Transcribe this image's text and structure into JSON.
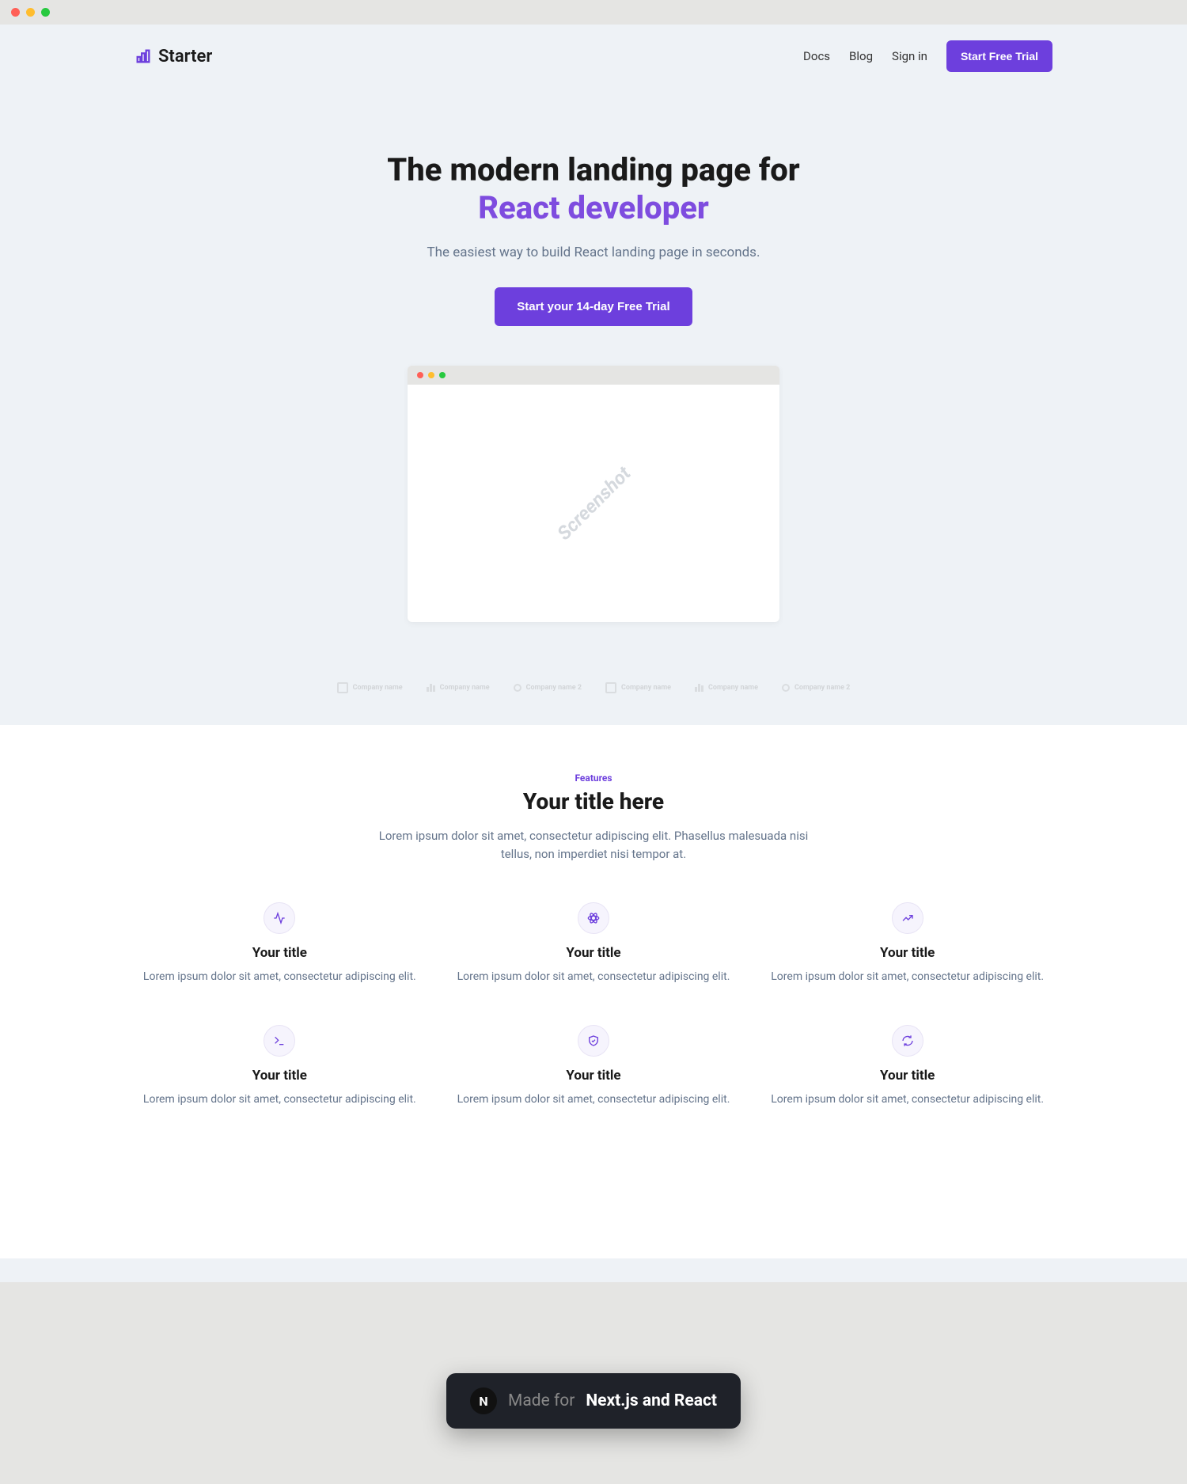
{
  "header": {
    "logo_text": "Starter",
    "nav": [
      "Docs",
      "Blog",
      "Sign in"
    ],
    "cta": "Start Free Trial"
  },
  "hero": {
    "title_line1": "The modern landing page for",
    "title_accent": "React developer",
    "subtitle": "The easiest way to build React landing page in seconds.",
    "cta": "Start your 14-day Free Trial",
    "screenshot_watermark": "Screenshot"
  },
  "logos": [
    "Company name",
    "Company name",
    "Company name 2",
    "Company name",
    "Company name",
    "Company name 2"
  ],
  "features": {
    "eyebrow": "Features",
    "title": "Your title here",
    "subtitle": "Lorem ipsum dolor sit amet, consectetur adipiscing elit. Phasellus malesuada nisi tellus, non imperdiet nisi tempor at.",
    "items": [
      {
        "title": "Your title",
        "desc": "Lorem ipsum dolor sit amet, consectetur adipiscing elit."
      },
      {
        "title": "Your title",
        "desc": "Lorem ipsum dolor sit amet, consectetur adipiscing elit."
      },
      {
        "title": "Your title",
        "desc": "Lorem ipsum dolor sit amet, consectetur adipiscing elit."
      },
      {
        "title": "Your title",
        "desc": "Lorem ipsum dolor sit amet, consectetur adipiscing elit."
      },
      {
        "title": "Your title",
        "desc": "Lorem ipsum dolor sit amet, consectetur adipiscing elit."
      },
      {
        "title": "Your title",
        "desc": "Lorem ipsum dolor sit amet, consectetur adipiscing elit."
      }
    ]
  },
  "toast": {
    "icon_letter": "N",
    "prefix": "Made for",
    "bold": "Next.js and React"
  }
}
